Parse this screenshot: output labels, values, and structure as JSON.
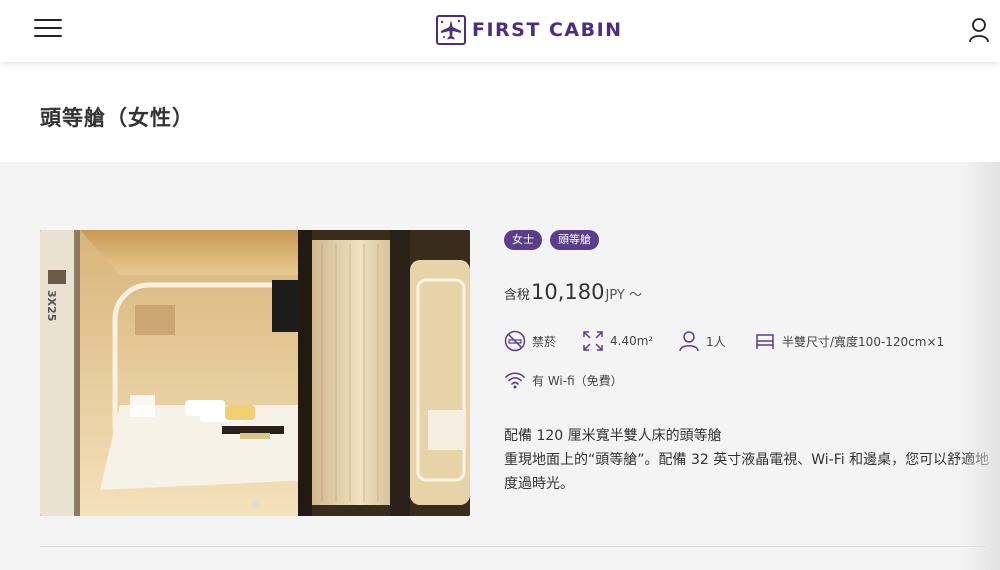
{
  "header": {
    "brand": "FIRST CABIN",
    "menu_icon": "hamburger-menu-icon",
    "user_icon": "user-icon",
    "brand_color": "#4b2d83"
  },
  "page": {
    "title": "頭等艙（女性）"
  },
  "room": {
    "photo_label": "3X25",
    "tags": [
      "女士",
      "頭等艙"
    ],
    "tag_color": "#5b3d8e",
    "price": {
      "prefix": "含稅",
      "value": "10,180",
      "suffix": "JPY ～"
    },
    "features": {
      "smoking": "禁菸",
      "area": "4.40m²",
      "capacity": "1人",
      "bed": "半雙尺寸/寬度100-120cm×1",
      "wifi": "有 Wi-fi（免費）"
    },
    "description": {
      "heading": "配備 120 厘米寬半雙人床的頭等艙",
      "body": "重現地面上的“頭等艙”。配備 32 英寸液晶電視、Wi-Fi 和邊桌，您可以舒適地度過時光。"
    }
  }
}
